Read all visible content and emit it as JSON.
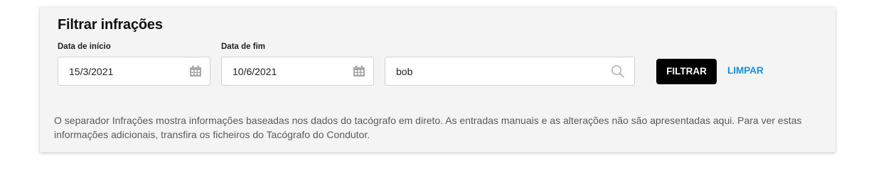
{
  "filter_panel": {
    "title": "Filtrar infrações",
    "start_date": {
      "label": "Data de início",
      "value": "15/3/2021"
    },
    "end_date": {
      "label": "Data de fim",
      "value": "10/6/2021"
    },
    "search": {
      "value": "bob"
    },
    "filter_button_label": "FILTRAR",
    "clear_button_label": "LIMPAR",
    "info_text": "O separador Infrações mostra informações baseadas nos dados do tacógrafo em direto. As entradas manuais e as alterações não são apresentadas aqui. Para ver estas informações adicionais, transfira os ficheiros do Tacógrafo do Condutor."
  },
  "icons": {
    "start_date_icon": "calendar-icon",
    "end_date_icon": "calendar-icon",
    "search_icon": "search-icon"
  },
  "colors": {
    "panel_background": "#f4f4f4",
    "filter_button": "#000000",
    "clear_link": "#1a8fd1",
    "info_text": "#5a5a5a"
  }
}
